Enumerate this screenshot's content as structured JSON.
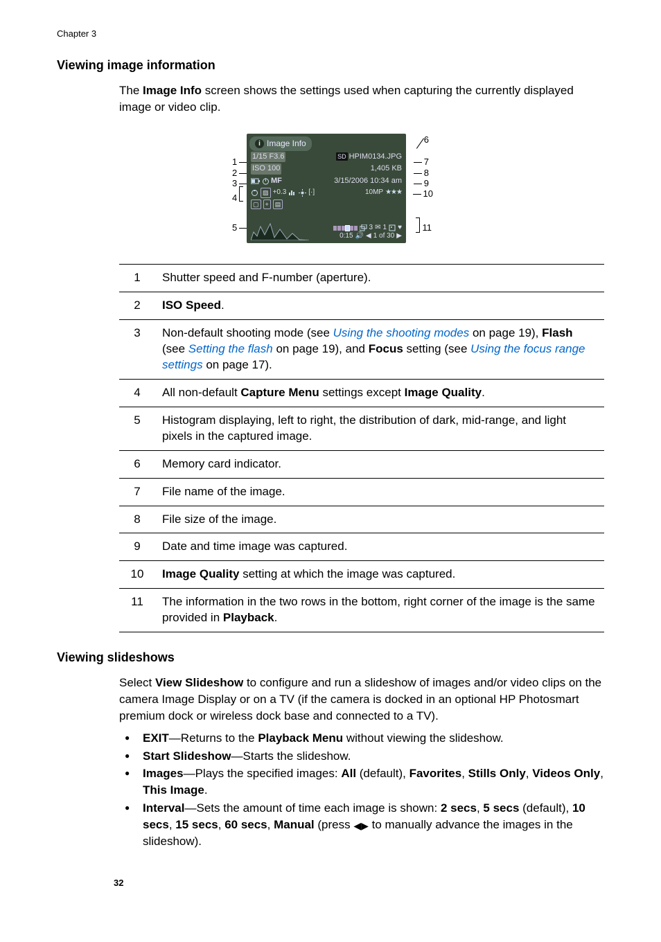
{
  "chapter": "Chapter 3",
  "sections": {
    "imageInfo": {
      "heading": "Viewing image information",
      "intro_1": "The ",
      "intro_bold": "Image Info",
      "intro_2": " screen shows the settings used when capturing the currently displayed image or video clip."
    },
    "slideshows": {
      "heading": "Viewing slideshows",
      "intro_1": "Select ",
      "intro_bold": "View Slideshow",
      "intro_2": " to configure and run a slideshow of images and/or video clips on the camera Image Display or on a TV (if the camera is docked in an optional HP Photosmart premium dock or wireless dock base and connected to a TV)."
    }
  },
  "lcd": {
    "title": "Image Info",
    "shutter": "1/15 F3.6",
    "filename": "HPIM0134.JPG",
    "iso": "ISO 100",
    "filesize": "1,405 KB",
    "mode": "MF",
    "datetime": "3/15/2006 10:34 am",
    "caps_ev": "+0.3",
    "caps_mp": "10MP",
    "caps_stars": "★★★",
    "bottom_stack": "3",
    "bottom_fav": "1",
    "bottom_time": "0:15",
    "bottom_counter": "1 of 30"
  },
  "callouts": [
    "1",
    "2",
    "3",
    "4",
    "5",
    "6",
    "7",
    "8",
    "9",
    "10",
    "11"
  ],
  "definitions": {
    "1": "Shutter speed and F-number (aperture).",
    "2_bold": "ISO Speed",
    "3_pre": "Non-default shooting mode (see ",
    "3_link1": "Using the shooting modes",
    "3_mid1": " on page 19), ",
    "3_bold1": "Flash",
    "3_mid2": " (see ",
    "3_link2": "Setting the flash",
    "3_mid3": " on page 19), and ",
    "3_bold2": "Focus",
    "3_mid4": " setting (see ",
    "3_link3": "Using the focus range settings",
    "3_tail": " on page 17).",
    "4_pre": "All non-default ",
    "4_bold1": "Capture Menu",
    "4_mid": " settings except ",
    "4_bold2": "Image Quality",
    "5": "Histogram displaying, left to right, the distribution of dark, mid-range, and light pixels in the captured image.",
    "6": "Memory card indicator.",
    "7": "File name of the image.",
    "8": "File size of the image.",
    "9": "Date and time image was captured.",
    "10_bold": "Image Quality",
    "10_rest": " setting at which the image was captured.",
    "11_pre": "The information in the two rows in the bottom, right corner of the image is the same provided in ",
    "11_bold": "Playback"
  },
  "bullets": {
    "exit_bold": "EXIT",
    "exit_rest": "—Returns to the ",
    "exit_bold2": "Playback Menu",
    "exit_tail": " without viewing the slideshow.",
    "start_bold": "Start Slideshow",
    "start_rest": "—Starts the slideshow.",
    "images_bold": "Images",
    "images_rest1": "—Plays the specified images: ",
    "images_all": "All",
    "images_def": " (default), ",
    "images_fav": "Favorites",
    "images_c1": ", ",
    "images_stills": "Stills Only",
    "images_c2": ", ",
    "images_videos": "Videos Only",
    "images_c3": ", ",
    "images_this": "This Image",
    "interval_bold": "Interval",
    "interval_rest1": "—Sets the amount of time each image is shown: ",
    "interval_2s": "2 secs",
    "interval_c1": ", ",
    "interval_5s": "5 secs",
    "interval_def": " (default), ",
    "interval_10s": "10 secs",
    "interval_c2": ", ",
    "interval_15s": "15 secs",
    "interval_c3": ", ",
    "interval_60s": "60 secs",
    "interval_c4": ", ",
    "interval_manual": "Manual",
    "interval_rest2": " (press ",
    "interval_rest3": " to manually advance the images in the slideshow)."
  },
  "pageNumber": "32"
}
